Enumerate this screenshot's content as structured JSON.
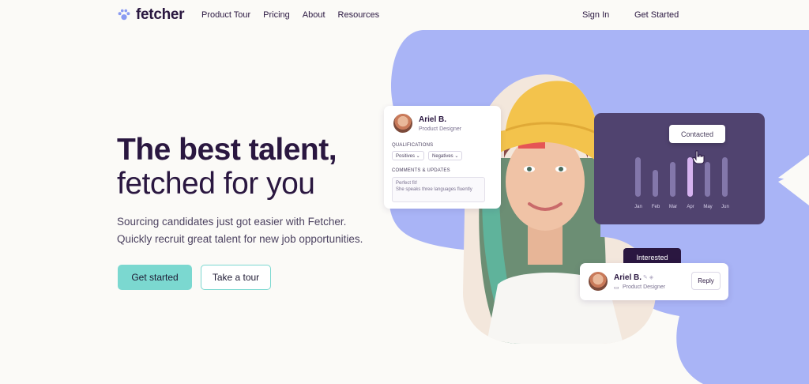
{
  "nav": {
    "brand": "fetcher",
    "links": [
      "Product Tour",
      "Pricing",
      "About",
      "Resources"
    ],
    "sign_in": "Sign In",
    "get_started": "Get Started"
  },
  "hero": {
    "title_bold": "The best talent,",
    "title_light": "fetched for you",
    "subtitle_line1": "Sourcing candidates just got easier with Fetcher.",
    "subtitle_line2": "Quickly recruit great talent for new job opportunities.",
    "primary_cta": "Get started",
    "secondary_cta": "Take a tour"
  },
  "profile_card": {
    "name": "Ariel B.",
    "role": "Product Designer",
    "qualifications_label": "QUALIFICATIONS",
    "chips": [
      "Positives",
      "Negatives"
    ],
    "comments_label": "COMMENTS & UPDATES",
    "comment_line1": "Perfect fit!",
    "comment_line2": "She speaks three languages fluently"
  },
  "chart_card": {
    "months": [
      "Jan",
      "Feb",
      "Mar",
      "Apr",
      "May",
      "Jun"
    ],
    "bar_levels": [
      [
        0.62,
        0.62
      ],
      [
        0.42,
        0.42
      ],
      [
        0.55,
        0.55
      ],
      [
        0.62,
        0.62
      ],
      [
        0.55,
        0.55
      ],
      [
        0.62,
        0.62
      ]
    ],
    "highlight_index": 3,
    "tooltip": "Contacted"
  },
  "status_card": {
    "badge": "Interested",
    "name": "Ariel B.",
    "role": "Product Designer",
    "reply": "Reply"
  },
  "colors": {
    "blob": "#a9b4f6",
    "accent": "#7bd8d0",
    "dark": "#2a1740",
    "chart_bg": "#50436f"
  }
}
